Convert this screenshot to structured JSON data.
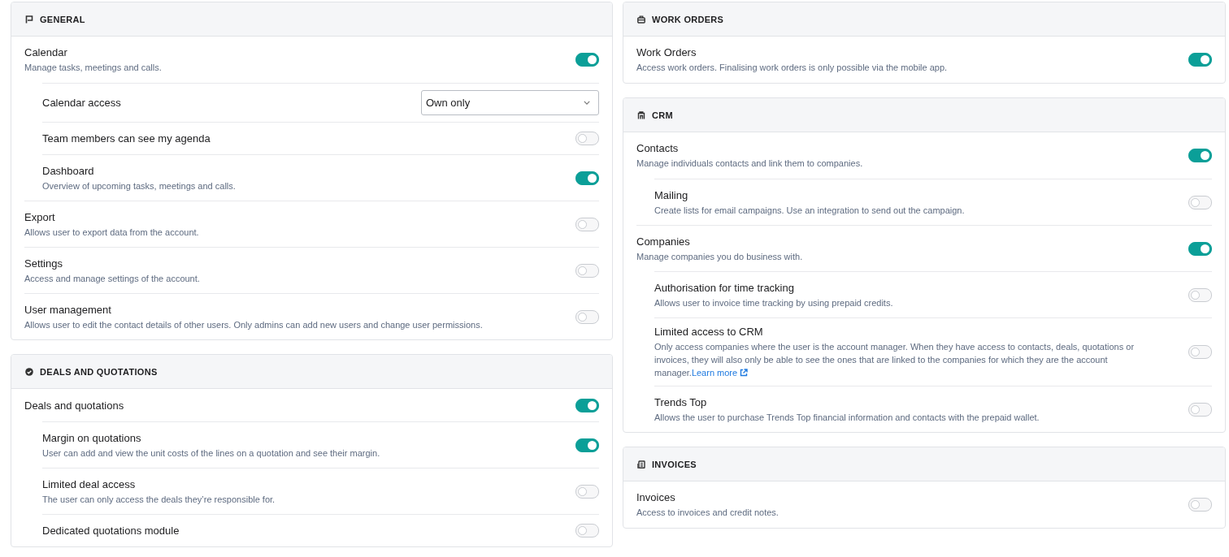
{
  "columns": [
    {
      "sections": [
        {
          "title": "GENERAL",
          "items": [
            {
              "kind": "toggle",
              "title": "Calendar",
              "description": "Manage tasks, meetings and calls.",
              "on": true,
              "children": [
                {
                  "kind": "select",
                  "title": "Calendar access",
                  "value": "Own only"
                },
                {
                  "kind": "toggle",
                  "title": "Team members can see my agenda",
                  "on": false
                },
                {
                  "kind": "toggle",
                  "title": "Dashboard",
                  "description": "Overview of upcoming tasks, meetings and calls.",
                  "on": true
                }
              ]
            },
            {
              "kind": "toggle",
              "title": "Export",
              "description": "Allows user to export data from the account.",
              "on": false
            },
            {
              "kind": "toggle",
              "title": "Settings",
              "description": "Access and manage settings of the account.",
              "on": false
            },
            {
              "kind": "toggle",
              "title": "User management",
              "description": "Allows user to edit the contact details of other users. Only admins can add new users and change user permissions.",
              "on": false
            }
          ]
        },
        {
          "title": "DEALS AND QUOTATIONS",
          "items": [
            {
              "kind": "toggle",
              "title": "Deals and quotations",
              "on": true,
              "children": [
                {
                  "kind": "toggle",
                  "title": "Margin on quotations",
                  "description": "User can add and view the unit costs of the lines on a quotation and see their margin.",
                  "on": true
                },
                {
                  "kind": "toggle",
                  "title": "Limited deal access",
                  "description": "The user can only access the deals they’re responsible for.",
                  "on": false
                },
                {
                  "kind": "toggle",
                  "title": "Dedicated quotations module",
                  "on": false
                }
              ]
            }
          ]
        }
      ]
    },
    {
      "sections": [
        {
          "title": "WORK ORDERS",
          "items": [
            {
              "kind": "toggle",
              "title": "Work Orders",
              "description": "Access work orders. Finalising work orders is only possible via the mobile app.",
              "on": true
            }
          ]
        },
        {
          "title": "CRM",
          "items": [
            {
              "kind": "toggle",
              "title": "Contacts",
              "description": "Manage individuals contacts and link them to companies.",
              "on": true,
              "children": [
                {
                  "kind": "toggle",
                  "title": "Mailing",
                  "description": "Create lists for email campaigns. Use an integration to send out the campaign.",
                  "on": false
                }
              ]
            },
            {
              "kind": "toggle",
              "title": "Companies",
              "description": "Manage companies you do business with.",
              "on": true,
              "children": [
                {
                  "kind": "toggle",
                  "title": "Authorisation for time tracking",
                  "description": "Allows user to invoice time tracking by using prepaid credits.",
                  "on": false
                },
                {
                  "kind": "toggle",
                  "title": "Limited access to CRM",
                  "description": "Only access companies where the user is the account manager. When they have access to contacts, deals, quotations or invoices, they will also only be able to see the ones that are linked to the companies for which they are the account manager.",
                  "link": "Learn more",
                  "on": false
                },
                {
                  "kind": "toggle",
                  "title": "Trends Top",
                  "description": "Allows the user to purchase Trends Top financial information and contacts with the prepaid wallet.",
                  "on": false
                }
              ]
            }
          ]
        },
        {
          "title": "INVOICES",
          "items": [
            {
              "kind": "toggle",
              "title": "Invoices",
              "description": "Access to invoices and credit notes.",
              "on": false
            }
          ]
        }
      ]
    }
  ]
}
